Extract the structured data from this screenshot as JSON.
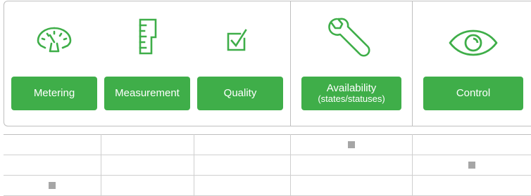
{
  "accent_color": "#3fae49",
  "icon_color": "#3fae49",
  "marker_color": "#a6a6a6",
  "categories": [
    {
      "icon": "gauge-icon",
      "label": "Metering",
      "sublabel": ""
    },
    {
      "icon": "ruler-icon",
      "label": "Measurement",
      "sublabel": ""
    },
    {
      "icon": "checkbox-icon",
      "label": "Quality",
      "sublabel": ""
    },
    {
      "icon": "wrench-icon",
      "label": "Availability",
      "sublabel": "(states/statuses)"
    },
    {
      "icon": "eye-icon",
      "label": "Control",
      "sublabel": ""
    }
  ],
  "matrix": {
    "rows": [
      [
        false,
        false,
        false,
        true,
        false
      ],
      [
        false,
        false,
        false,
        false,
        true
      ],
      [
        true,
        false,
        false,
        false,
        false
      ]
    ]
  }
}
